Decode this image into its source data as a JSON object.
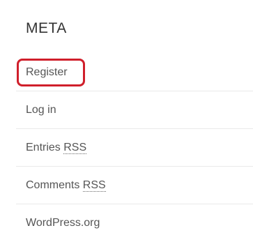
{
  "widget": {
    "title": "META",
    "items": [
      {
        "label": "Register"
      },
      {
        "label": "Log in"
      },
      {
        "label_prefix": "Entries ",
        "abbr": "RSS"
      },
      {
        "label_prefix": "Comments ",
        "abbr": "RSS"
      },
      {
        "label": "WordPress.org"
      }
    ]
  },
  "colors": {
    "highlight": "#d01f2b",
    "text": "#555555",
    "title": "#333333",
    "divider": "#e9e9e9"
  }
}
